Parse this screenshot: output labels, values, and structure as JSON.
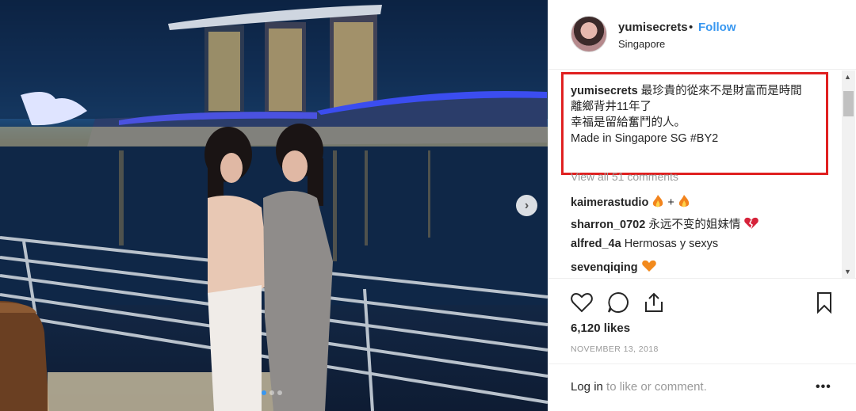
{
  "post": {
    "username": "yumisecrets",
    "dot": "•",
    "follow_label": "Follow",
    "location": "Singapore",
    "caption_user": "yumisecrets",
    "caption_lines": [
      "最珍貴的從來不是財富而是時間",
      "離鄉背井11年了",
      "幸福是留給奮鬥的人。",
      "Made in Singapore SG #BY2"
    ],
    "view_all": "View all 51 comments",
    "comments": [
      {
        "user": "kaimerastudio",
        "text": " + "
      },
      {
        "user": "sharron_0702",
        "text": "永远不变的姐妹情"
      },
      {
        "user": "alfred_4a",
        "text": "Hermosas y sexys"
      },
      {
        "user": "sevenqiqing",
        "text": ""
      }
    ],
    "likes": "6,120 likes",
    "date": "NOVEMBER 13, 2018",
    "login_link": "Log in",
    "login_rest": " to like or comment.",
    "more": "•••"
  },
  "icons": {
    "heart": "heart-outline-icon",
    "comment": "comment-bubble-icon",
    "share": "share-upload-icon",
    "bookmark": "bookmark-icon",
    "fire": "fire-emoji",
    "broken_heart": "broken-heart-emoji",
    "orange_heart": "orange-heart-emoji"
  },
  "colors": {
    "link": "#3897f0",
    "highlight": "#e02020",
    "text": "#262626",
    "muted": "#999999"
  }
}
